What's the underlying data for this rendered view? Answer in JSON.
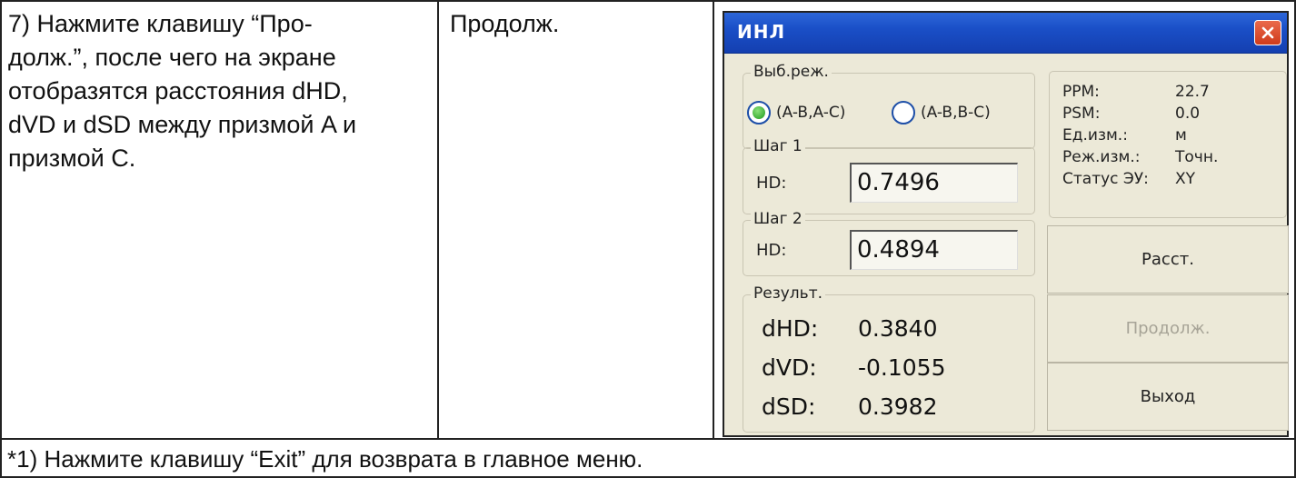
{
  "instruction": {
    "lines": [
      "7) Нажмите клавишу “Про-",
      "долж.”, после чего на экране",
      "отобразятся расстояния dHD,",
      "dVD и dSD между призмой A и",
      "призмой C."
    ]
  },
  "key": "Продолж.",
  "footnote": "*1) Нажмите клавишу “Exit” для возврата в главное меню.",
  "window": {
    "title": "ИНЛ",
    "mode_group": {
      "label": "Выб.реж.",
      "options": [
        {
          "label": "(A-B,A-C)",
          "selected": true
        },
        {
          "label": "(A-B,B-C)",
          "selected": false
        }
      ]
    },
    "step1": {
      "label": "Шаг 1",
      "field_label": "HD:",
      "value": "0.7496"
    },
    "step2": {
      "label": "Шаг 2",
      "field_label": "HD:",
      "value": "0.4894"
    },
    "result": {
      "label": "Результ.",
      "rows": [
        {
          "key": "dHD:",
          "value": "0.3840"
        },
        {
          "key": "dVD:",
          "value": "-0.1055"
        },
        {
          "key": "dSD:",
          "value": "0.3982"
        }
      ]
    },
    "info": [
      {
        "key": "PPM:",
        "value": "22.7"
      },
      {
        "key": "PSM:",
        "value": "0.0"
      },
      {
        "key": "Ед.изм.:",
        "value": "м"
      },
      {
        "key": "Реж.изм.:",
        "value": "Точн."
      },
      {
        "key": "Статус ЭУ:",
        "value": "XY"
      }
    ],
    "buttons": {
      "measure": "Расст.",
      "continue": "Продолж.",
      "exit": "Выход"
    }
  }
}
